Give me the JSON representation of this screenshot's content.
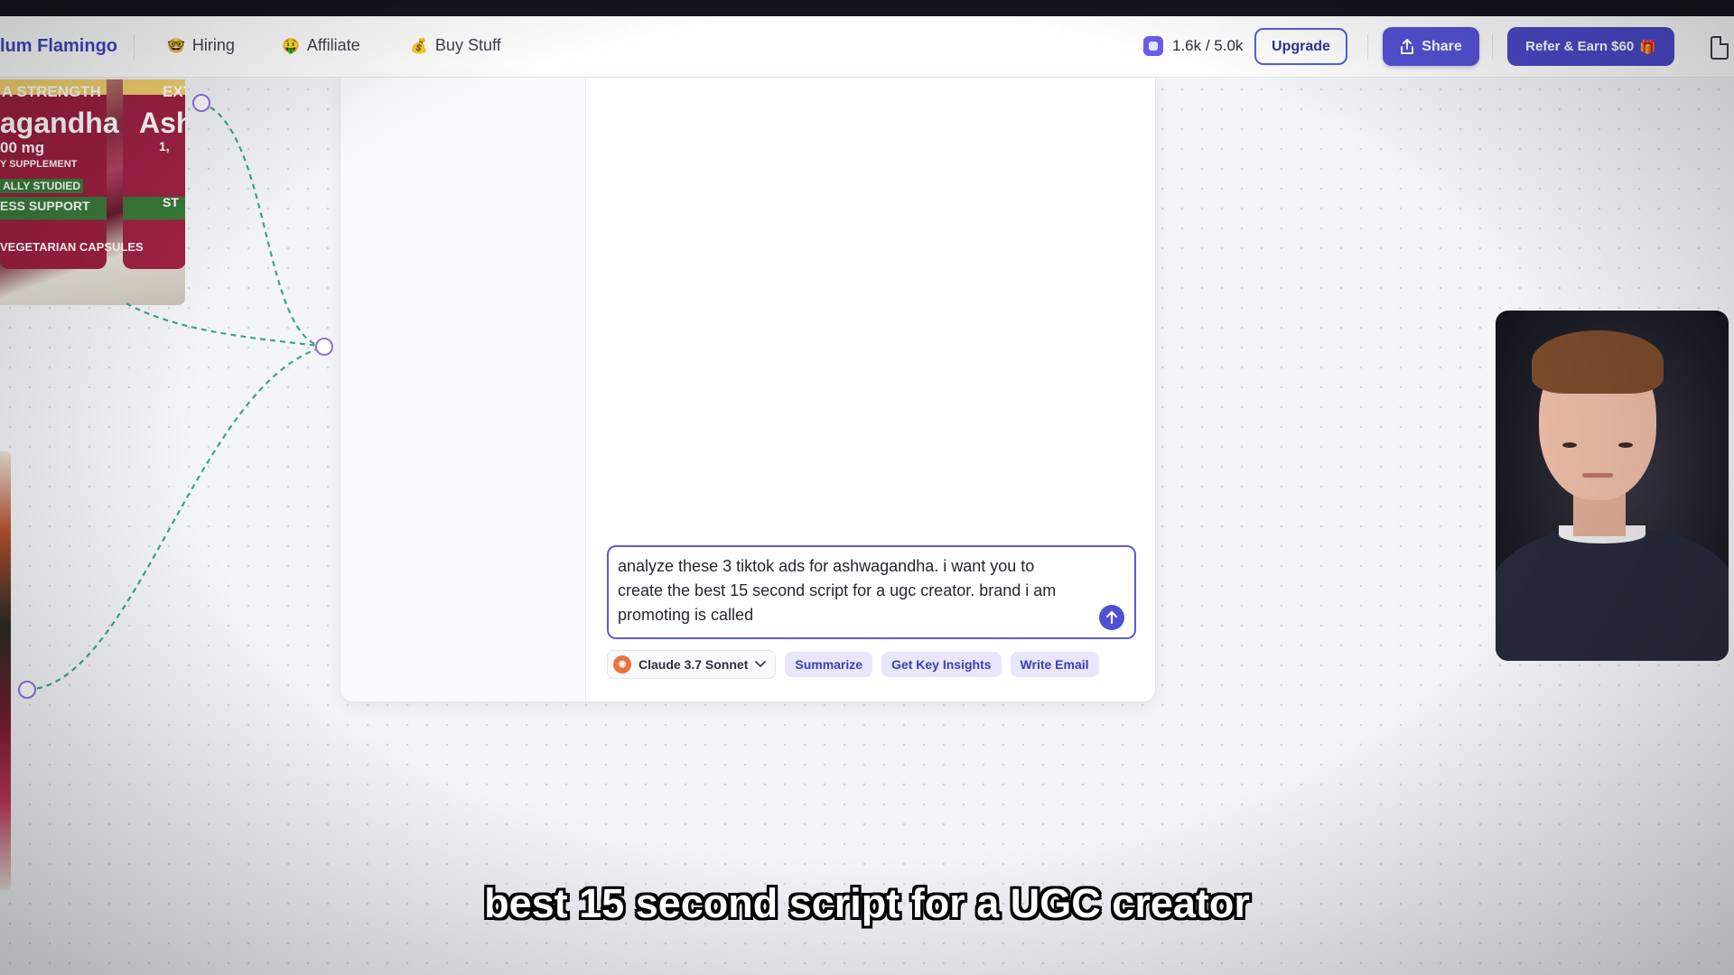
{
  "topbar": {
    "workspace_name": "lum Flamingo",
    "nav": [
      {
        "emoji": "🤓",
        "label": "Hiring"
      },
      {
        "emoji": "🤑",
        "label": "Affiliate"
      },
      {
        "emoji": "💰",
        "label": "Buy Stuff"
      }
    ],
    "credits": "1.6k / 5.0k",
    "upgrade_label": "Upgrade",
    "share_label": "Share",
    "refer_label": "Refer & Earn $60",
    "refer_emoji": "🎁"
  },
  "product_image": {
    "texts": [
      "A STRENGTH",
      "EXT",
      "agandha",
      "Ash",
      "00 mg",
      "Y SUPPLEMENT",
      "ALLY STUDIED",
      "ESS SUPPORT",
      "VEGETARIAN CAPSULES",
      "ST",
      "1,"
    ]
  },
  "chat": {
    "prompt_text": "analyze these 3 tiktok ads for ashwagandha. i want you to\ncreate the best 15 second script for a ugc creator. brand i am\npromoting is called",
    "model": "Claude 3.7 Sonnet",
    "quick_actions": [
      "Summarize",
      "Get Key Insights",
      "Write Email"
    ]
  },
  "caption": "best 15 second script for a UGC creator",
  "colors": {
    "accent": "#5453d6",
    "connector": "#3aa58a",
    "node": "#8e71e6"
  }
}
